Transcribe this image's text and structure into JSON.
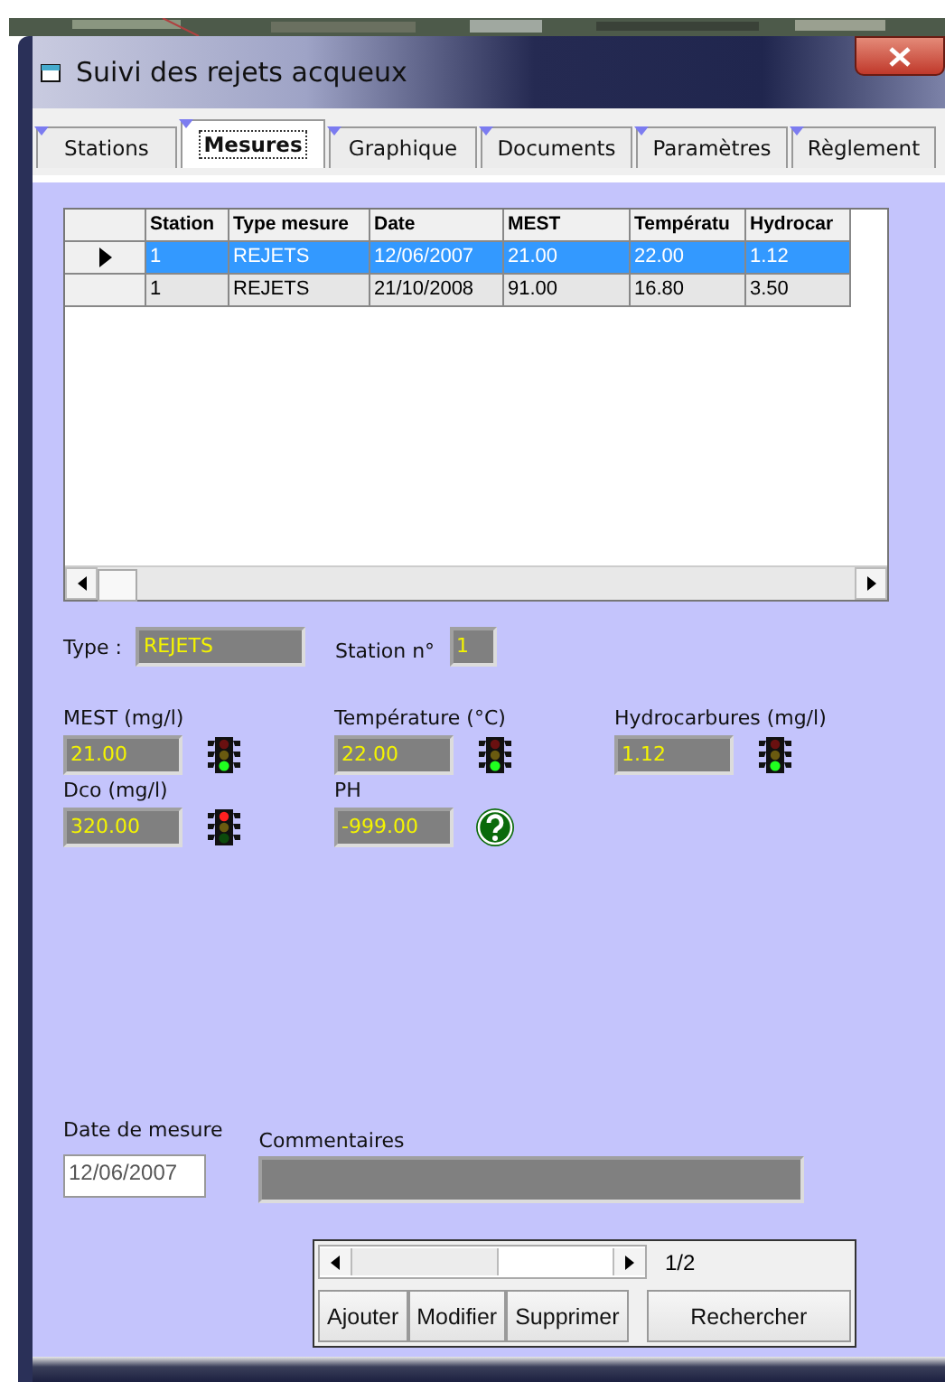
{
  "window": {
    "title": "Suivi des rejets acqueux"
  },
  "tabs": [
    {
      "label": "Stations",
      "selected": false
    },
    {
      "label": "Mesures",
      "selected": true
    },
    {
      "label": "Graphique",
      "selected": false
    },
    {
      "label": "Documents",
      "selected": false
    },
    {
      "label": "Paramètres",
      "selected": false
    },
    {
      "label": "Règlement",
      "selected": false
    }
  ],
  "table": {
    "columns": [
      "Station",
      "Type mesure",
      "Date",
      "MEST",
      "Températu",
      "Hydrocar"
    ],
    "rows": [
      {
        "selected": true,
        "cells": [
          "1",
          "REJETS",
          "12/06/2007",
          "21.00",
          "22.00",
          "1.12"
        ]
      },
      {
        "selected": false,
        "cells": [
          "1",
          "REJETS",
          "21/10/2008",
          "91.00",
          "16.80",
          "3.50"
        ]
      }
    ]
  },
  "type": {
    "label": "Type :",
    "value": "REJETS"
  },
  "station": {
    "label": "Station n°",
    "value": "1"
  },
  "measures": [
    {
      "label": "MEST (mg/l)",
      "value": "21.00",
      "kind": "light",
      "color": "#20ff20"
    },
    {
      "label": "Température (°C)",
      "value": "22.00",
      "kind": "light",
      "color": "#20ff20"
    },
    {
      "label": "Hydrocarbures (mg/l)",
      "value": "1.12",
      "kind": "light",
      "color": "#20ff20"
    },
    {
      "label": "Dco (mg/l)",
      "value": "320.00",
      "kind": "light",
      "color": "#ff2020"
    },
    {
      "label": "PH",
      "value": "-999.00",
      "kind": "unknown"
    }
  ],
  "date": {
    "label": "Date de mesure",
    "value": "12/06/2007"
  },
  "comments": {
    "label": "Commentaires"
  },
  "navigator": {
    "position": "1/2",
    "buttons": [
      "Ajouter",
      "Modifier",
      "Supprimer",
      "Rechercher"
    ]
  }
}
